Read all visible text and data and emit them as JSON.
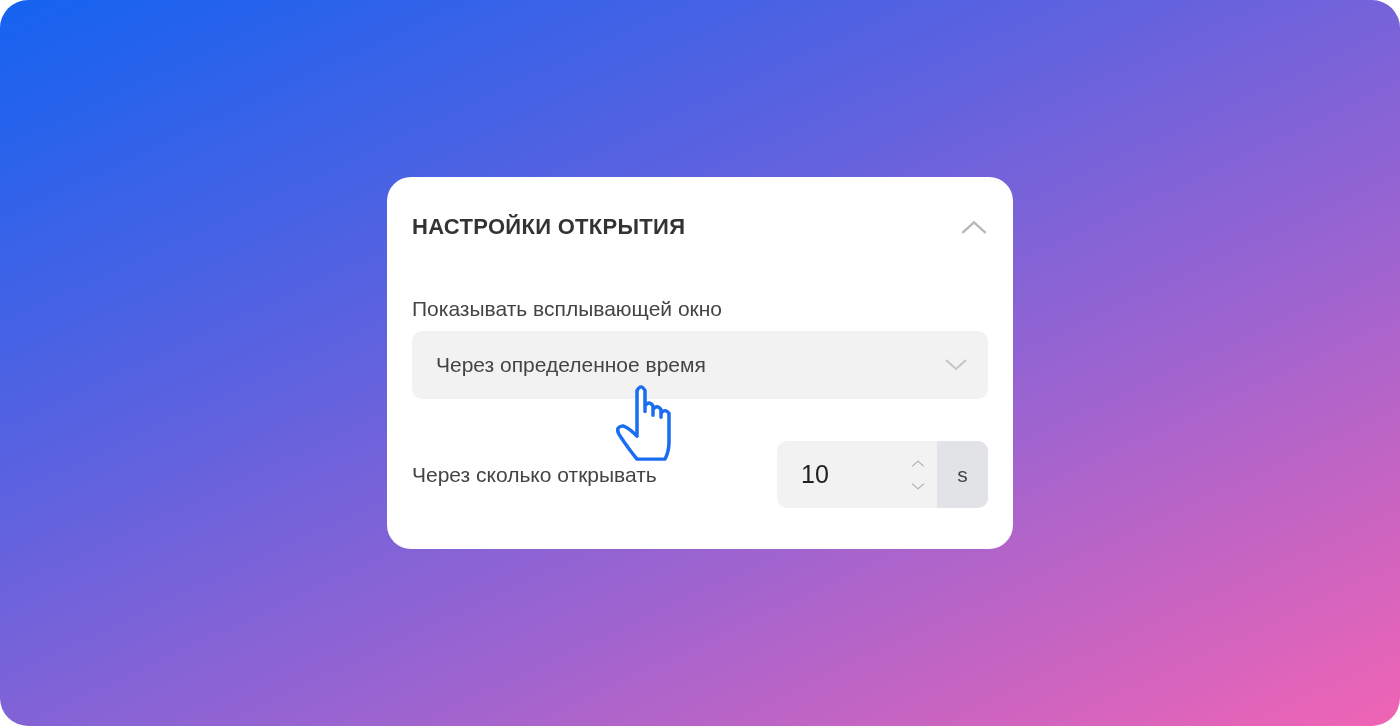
{
  "section": {
    "title": "НАСТРОЙКИ ОТКРЫТИЯ",
    "expanded": true
  },
  "select": {
    "label": "Показывать всплывающей окно",
    "value": "Через определенное время"
  },
  "delay": {
    "label": "Через сколько открывать",
    "value": "10",
    "unit": "s"
  }
}
